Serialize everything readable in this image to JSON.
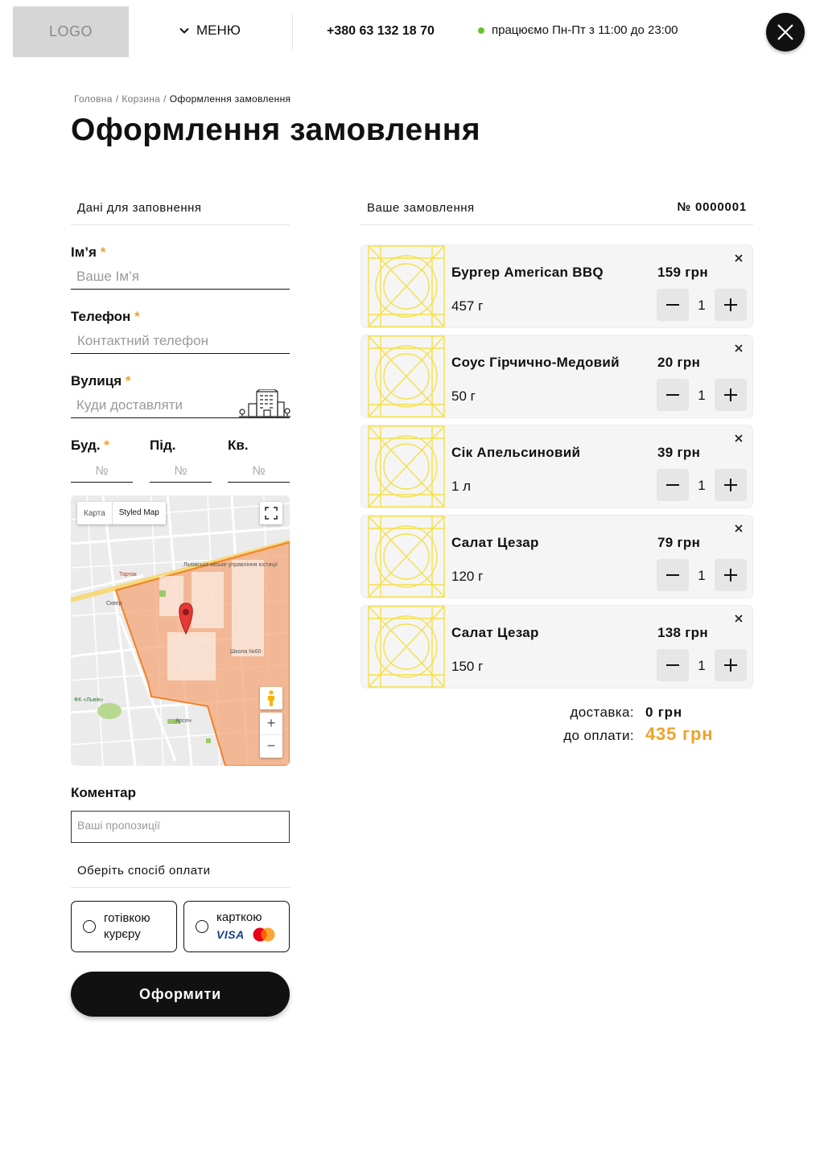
{
  "header": {
    "logo": "LOGO",
    "menu_label": "МЕНЮ",
    "phone": "+380 63 132 18 70",
    "hours_prefix": "працюємо",
    "days": "Пн-Пт",
    "from_word": "з",
    "open_time": "11:00",
    "to_word": "до",
    "close_time": "23:00"
  },
  "breadcrumb": [
    "Головна",
    "Корзина",
    "Оформлення замовлення"
  ],
  "page_title": "Оформлення замовлення",
  "form": {
    "section_title": "Дані для заповнення",
    "name_label": "Ім’я",
    "name_placeholder": "Ваше Ім’я",
    "phone_label": "Телефон",
    "phone_placeholder": "Контактний телефон",
    "street_label": "Вулиця",
    "street_placeholder": "Куди доставляти",
    "building_label": "Буд.",
    "entrance_label": "Під.",
    "apt_label": "Кв.",
    "number_placeholder": "№",
    "required_mark": "*"
  },
  "map": {
    "tab_map": "Карта",
    "tab_styled": "Styled Map",
    "labels": [
      "Львівське міське управління юстиції",
      "Тартак",
      "Сквер",
      "Школа №60",
      "ФК «Львів»",
      "Арсен"
    ]
  },
  "comment": {
    "label": "Коментар",
    "placeholder": "Ваші пропозиції"
  },
  "payment": {
    "title": "Оберіть спосіб оплати",
    "cash_line1": "готівкою",
    "cash_line2": "курєру",
    "card_label": "карткою",
    "visa": "VISA"
  },
  "submit_label": "Оформити",
  "order": {
    "title": "Ваше замовлення",
    "number": "№ 0000001",
    "items": [
      {
        "name": "Бургер American BBQ",
        "weight": "457 г",
        "price": "159 грн",
        "qty": "1"
      },
      {
        "name": "Соус Гірчично-Медовий",
        "weight": "50 г",
        "price": "20 грн",
        "qty": "1"
      },
      {
        "name": "Сік Апельсиновий",
        "weight": "1 л",
        "price": "39 грн",
        "qty": "1"
      },
      {
        "name": "Салат Цезар",
        "weight": "120 г",
        "price": "79 грн",
        "qty": "1"
      },
      {
        "name": "Салат Цезар",
        "weight": "150 г",
        "price": "138 грн",
        "qty": "1"
      }
    ],
    "delivery_label": "доставка:",
    "delivery_value": "0 грн",
    "total_label": "до оплати:",
    "total_value": "435 грн"
  },
  "colors": {
    "accent": "#f0a22a",
    "status_green": "#6cc42a",
    "placeholder_yellow": "#f3e04a",
    "dark": "#111111"
  }
}
